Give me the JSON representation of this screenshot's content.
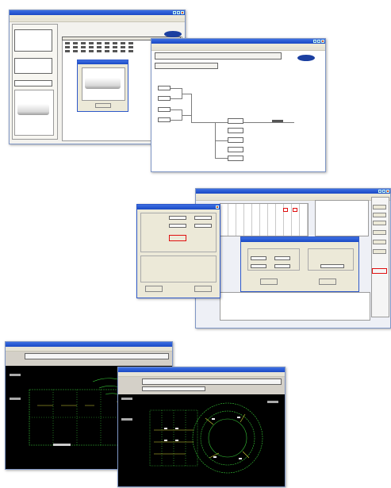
{
  "screenshots": [
    {
      "id": "s1",
      "title": "",
      "menu": ""
    },
    {
      "id": "s2",
      "title": "",
      "menu": ""
    },
    {
      "id": "s3",
      "title": "",
      "menu": ""
    },
    {
      "id": "s4",
      "title": "",
      "menu": ""
    },
    {
      "id": "s5",
      "title": "",
      "menu": ""
    },
    {
      "id": "s6",
      "title": "",
      "menu": ""
    }
  ],
  "colors": {
    "titlebar": "#2c5ad8",
    "window": "#f3f2ee",
    "cad_bg": "#000000",
    "highlight": "#e01010",
    "cad_lines": "#36c436"
  },
  "icons": [
    "samsung-logo-icon",
    "air-conditioner-icon",
    "close-icon"
  ]
}
